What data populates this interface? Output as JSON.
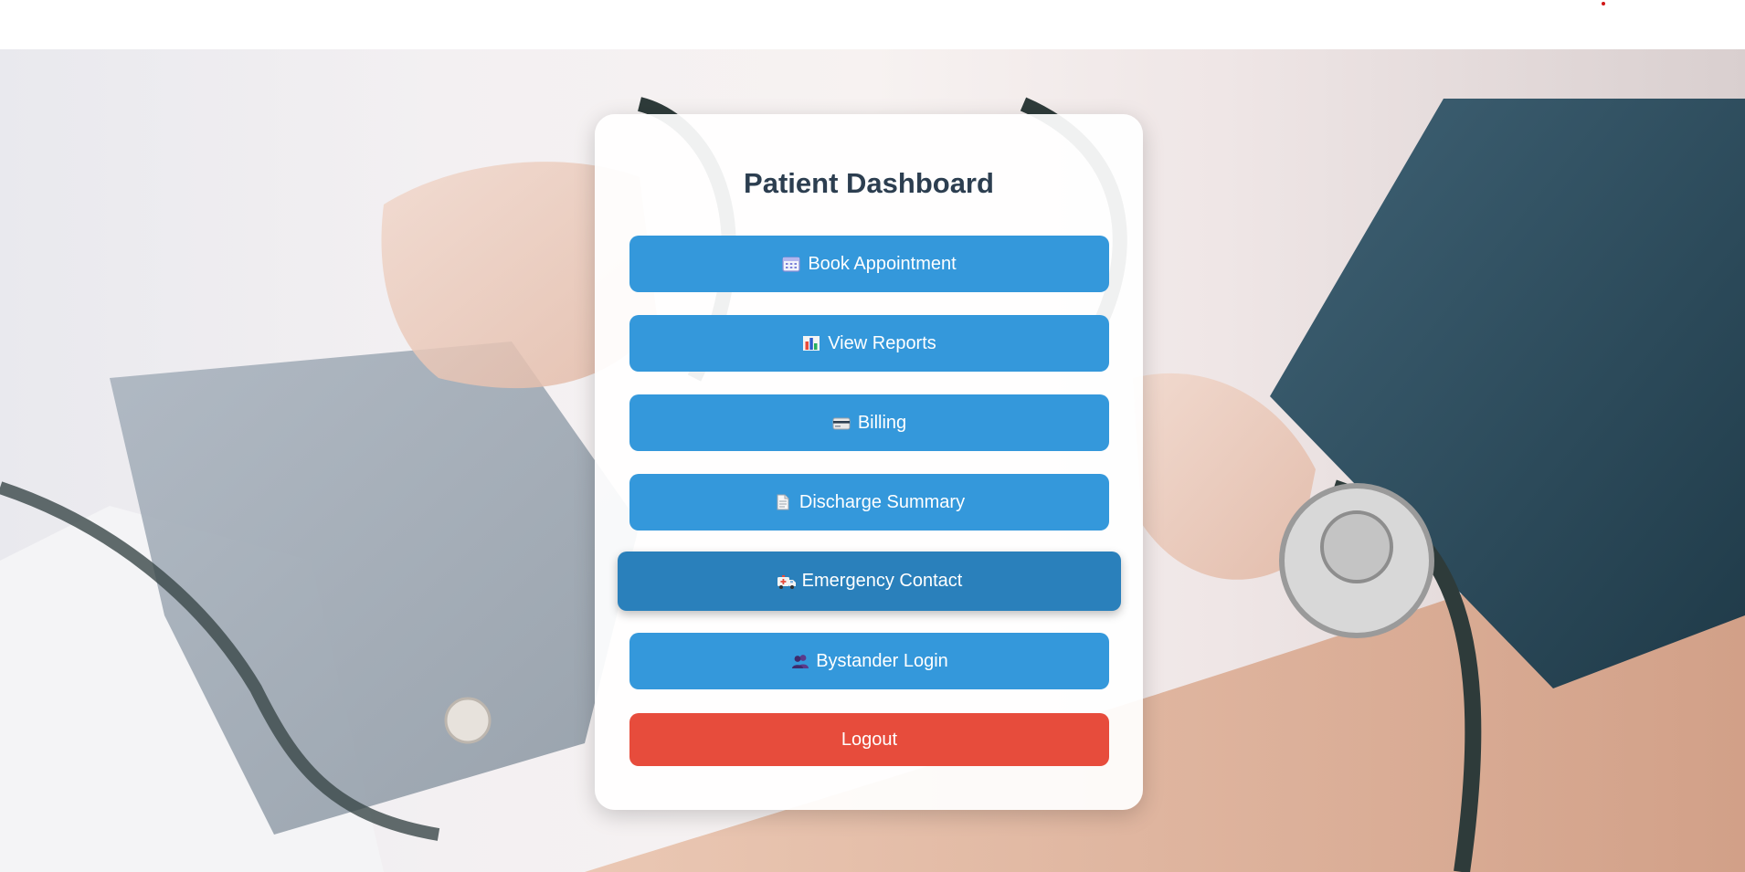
{
  "dashboard": {
    "title": "Patient Dashboard",
    "buttons": [
      {
        "label": "Book Appointment",
        "icon": "calendar-icon"
      },
      {
        "label": "View Reports",
        "icon": "bar-chart-icon"
      },
      {
        "label": "Billing",
        "icon": "credit-card-icon"
      },
      {
        "label": "Discharge Summary",
        "icon": "document-icon"
      },
      {
        "label": "Emergency Contact",
        "icon": "ambulance-icon"
      },
      {
        "label": "Bystander Login",
        "icon": "users-icon"
      }
    ],
    "logout_label": "Logout"
  },
  "colors": {
    "primary_button": "#3498db",
    "primary_button_hover": "#2a80bb",
    "logout_button": "#e74c3c",
    "title_text": "#2c3e50"
  }
}
